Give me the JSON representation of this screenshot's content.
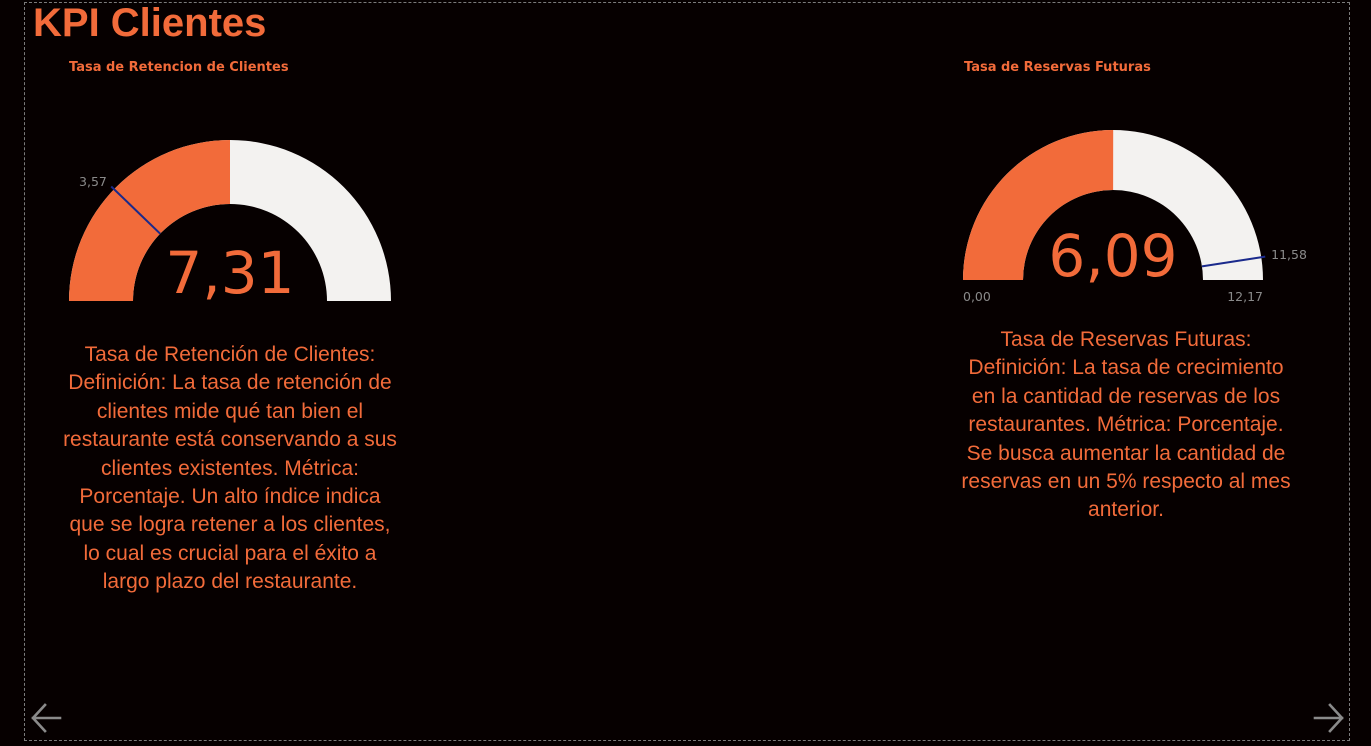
{
  "page": {
    "title": "KPI Clientes"
  },
  "colors": {
    "background": "#060000",
    "accent": "#f26b3a",
    "track": "#f3f2f0",
    "target_line": "#1a2a8c",
    "muted_label": "#8a8a8a",
    "nav_arrow": "#8a8a8a"
  },
  "gauges": [
    {
      "title": "Tasa de Retencion de Clientes",
      "value": 7.31,
      "value_label": "7,31",
      "min": 0,
      "max": 14.62,
      "min_label": "",
      "max_label": "",
      "target": 3.57,
      "target_label": "3,57",
      "description": "Tasa de Retención de Clientes: Definición: La tasa de retención de clientes mide qué tan bien el restaurante está conservando a sus clientes existentes. Métrica: Porcentaje. Un alto índice indica que se logra retener a los clientes, lo cual es crucial para el éxito a largo plazo del restaurante."
    },
    {
      "title": "Tasa de Reservas Futuras",
      "value": 6.09,
      "value_label": "6,09",
      "min": 0,
      "max": 12.17,
      "min_label": "0,00",
      "max_label": "12,17",
      "target": 11.58,
      "target_label": "11,58",
      "description": "Tasa de Reservas Futuras: Definición: La tasa de crecimiento en la cantidad de reservas de los restaurantes. Métrica: Porcentaje. Se busca aumentar la cantidad de reservas en un 5% respecto al mes anterior."
    }
  ],
  "navigation": {
    "prev_icon": "arrow-left-icon",
    "next_icon": "arrow-right-icon"
  }
}
